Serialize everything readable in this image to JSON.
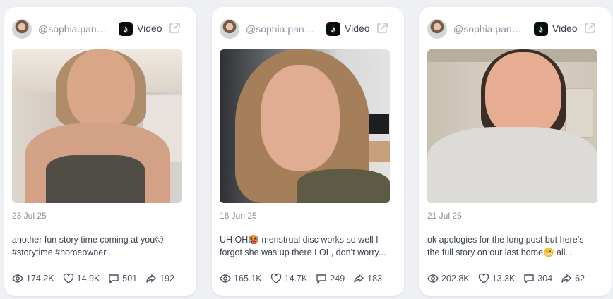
{
  "cards": [
    {
      "handle": "@sophia.panel...",
      "platform": "Video",
      "date": "23 Jul 25",
      "caption_line1": "another fun story time coming at you😛",
      "caption_line2": "#storytime #homeowner...",
      "views": "174.2K",
      "likes": "14.9K",
      "comments": "501",
      "shares": "192"
    },
    {
      "handle": "@sophia.panel...",
      "platform": "Video",
      "date": "16 Jun 25",
      "caption_line1": "UH OH🥵 menstrual disc works so well I",
      "caption_line2": "forgot she was up there LOL, don’t worry...",
      "views": "165.1K",
      "likes": "14.7K",
      "comments": "249",
      "shares": "183"
    },
    {
      "handle": "@sophia.panel...",
      "platform": "Video",
      "date": "21 Jul 25",
      "caption_line1": "ok apologies for the long post but here’s",
      "caption_line2": "the full story on our last home😬 all...",
      "views": "202.8K",
      "likes": "13.3K",
      "comments": "304",
      "shares": "62"
    }
  ],
  "colors": {
    "page_bg": "#eef0f4",
    "card_bg": "#ffffff",
    "muted_text": "#8d93a0",
    "body_text": "#3c4250"
  },
  "icons": [
    "tiktok-icon",
    "external-link-icon",
    "eye-icon",
    "heart-icon",
    "comment-icon",
    "share-icon"
  ]
}
